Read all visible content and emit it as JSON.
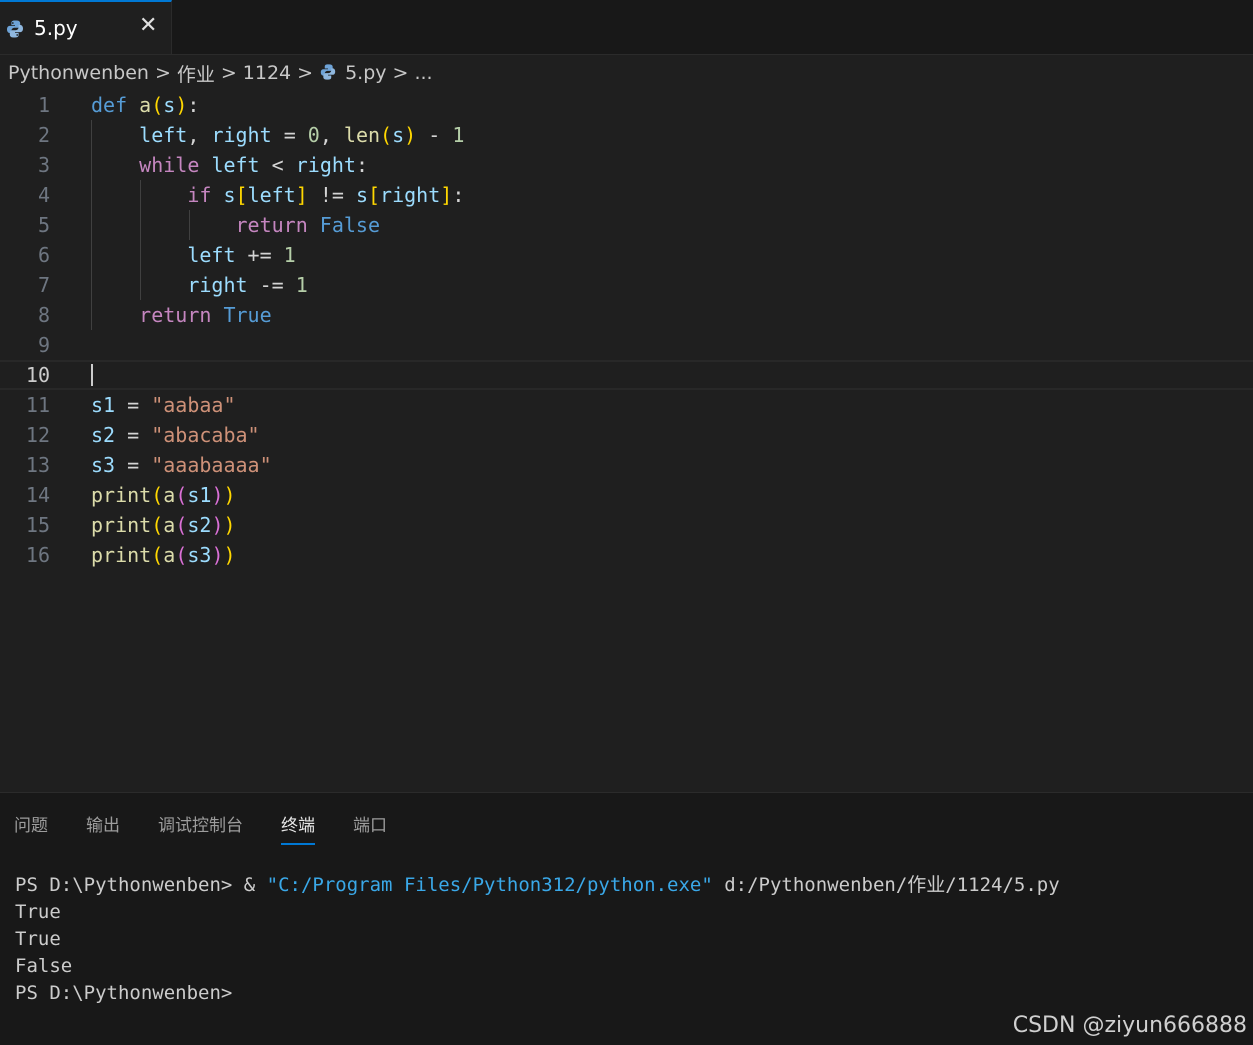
{
  "tab": {
    "filename": "5.py",
    "close_glyph": "✕",
    "icon": "python-file-icon"
  },
  "breadcrumb": {
    "items": [
      "Pythonwenben",
      "作业",
      "1124",
      "5.py",
      "..."
    ],
    "separator": ">"
  },
  "editor": {
    "line_numbers": [
      "1",
      "2",
      "3",
      "4",
      "5",
      "6",
      "7",
      "8",
      "9",
      "10",
      "11",
      "12",
      "13",
      "14",
      "15",
      "16"
    ],
    "current_line": "10",
    "tokens": {
      "def": "def",
      "while": "while",
      "if": "if",
      "return": "return",
      "false": "False",
      "true": "True",
      "fn_a": "a",
      "fn_len": "len",
      "fn_print": "print",
      "s": "s",
      "left": "left",
      "right": "right",
      "s1": "s1",
      "s2": "s2",
      "s3": "s3",
      "zero": "0",
      "one": "1",
      "str1": "\"aabaa\"",
      "str2": "\"abacaba\"",
      "str3": "\"aaabaaaa\""
    }
  },
  "panel": {
    "tabs": [
      "问题",
      "输出",
      "调试控制台",
      "终端",
      "端口"
    ],
    "active_tab": "终端",
    "terminal": {
      "prompt1": "PS D:\\Pythonwenben> & ",
      "exe_path": "\"C:/Program Files/Python312/python.exe\"",
      "script_path": " d:/Pythonwenben/作业/1124/5.py",
      "out1": "True",
      "out2": "True",
      "out3": "False",
      "prompt2": "PS D:\\Pythonwenben>"
    }
  },
  "watermark": "CSDN @ziyun666888",
  "colors": {
    "keyword": "#569cd6",
    "control": "#c586c0",
    "function": "#dcdcaa",
    "variable": "#9cdcfe",
    "number": "#b5cea8",
    "string": "#ce9178",
    "accent": "#0078d4"
  }
}
